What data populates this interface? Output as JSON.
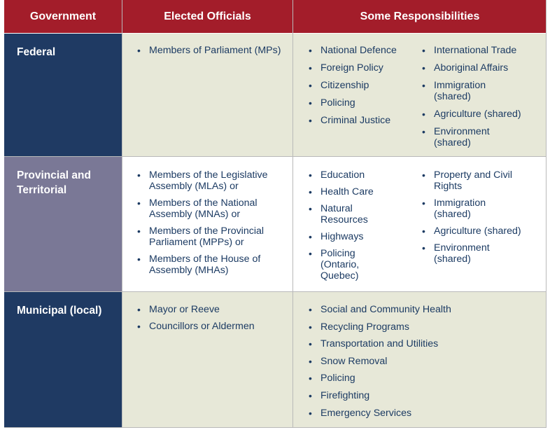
{
  "headers": {
    "government": "Government",
    "elected": "Elected Officials",
    "responsibilities": "Some Responsibilities"
  },
  "rows": {
    "federal": {
      "government": "Federal",
      "elected": [
        "Members of Parliament (MPs)"
      ],
      "resp_left": [
        "National Defence",
        "Foreign Policy",
        "Citizenship",
        "Policing",
        "Criminal Justice"
      ],
      "resp_right": [
        "International Trade",
        "Aboriginal Affairs",
        "Immigration (shared)",
        "Agriculture (shared)",
        "Environment (shared)"
      ]
    },
    "provincial": {
      "government": "Provincial and Territorial",
      "elected": [
        "Members of the Legislative Assembly (MLAs) or",
        "Members of the National Assembly (MNAs) or",
        "Members of the Provincial Parliament (MPPs) or",
        "Members of the House of Assembly (MHAs)"
      ],
      "resp_left": [
        "Education",
        "Health Care",
        "Natural Resources",
        "Highways",
        "Policing (Ontario, Quebec)"
      ],
      "resp_right": [
        "Property and Civil Rights",
        "Immigration (shared)",
        "Agriculture (shared)",
        "Environment (shared)"
      ]
    },
    "municipal": {
      "government": "Municipal (local)",
      "elected": [
        "Mayor or Reeve",
        "Councillors or Aldermen"
      ],
      "resp_left": [
        "Social and Community Health",
        "Recycling Programs",
        "Transportation and Utilities",
        "Snow Removal",
        "Policing",
        "Firefighting",
        "Emergency Services"
      ]
    }
  },
  "colors": {
    "header": "#a31d2a",
    "gov_federal": "#1f3a63",
    "gov_provincial": "#7a7896",
    "gov_municipal": "#1f3a63",
    "shaded_row": "#e7e8d8",
    "text": "#1c3b63"
  }
}
